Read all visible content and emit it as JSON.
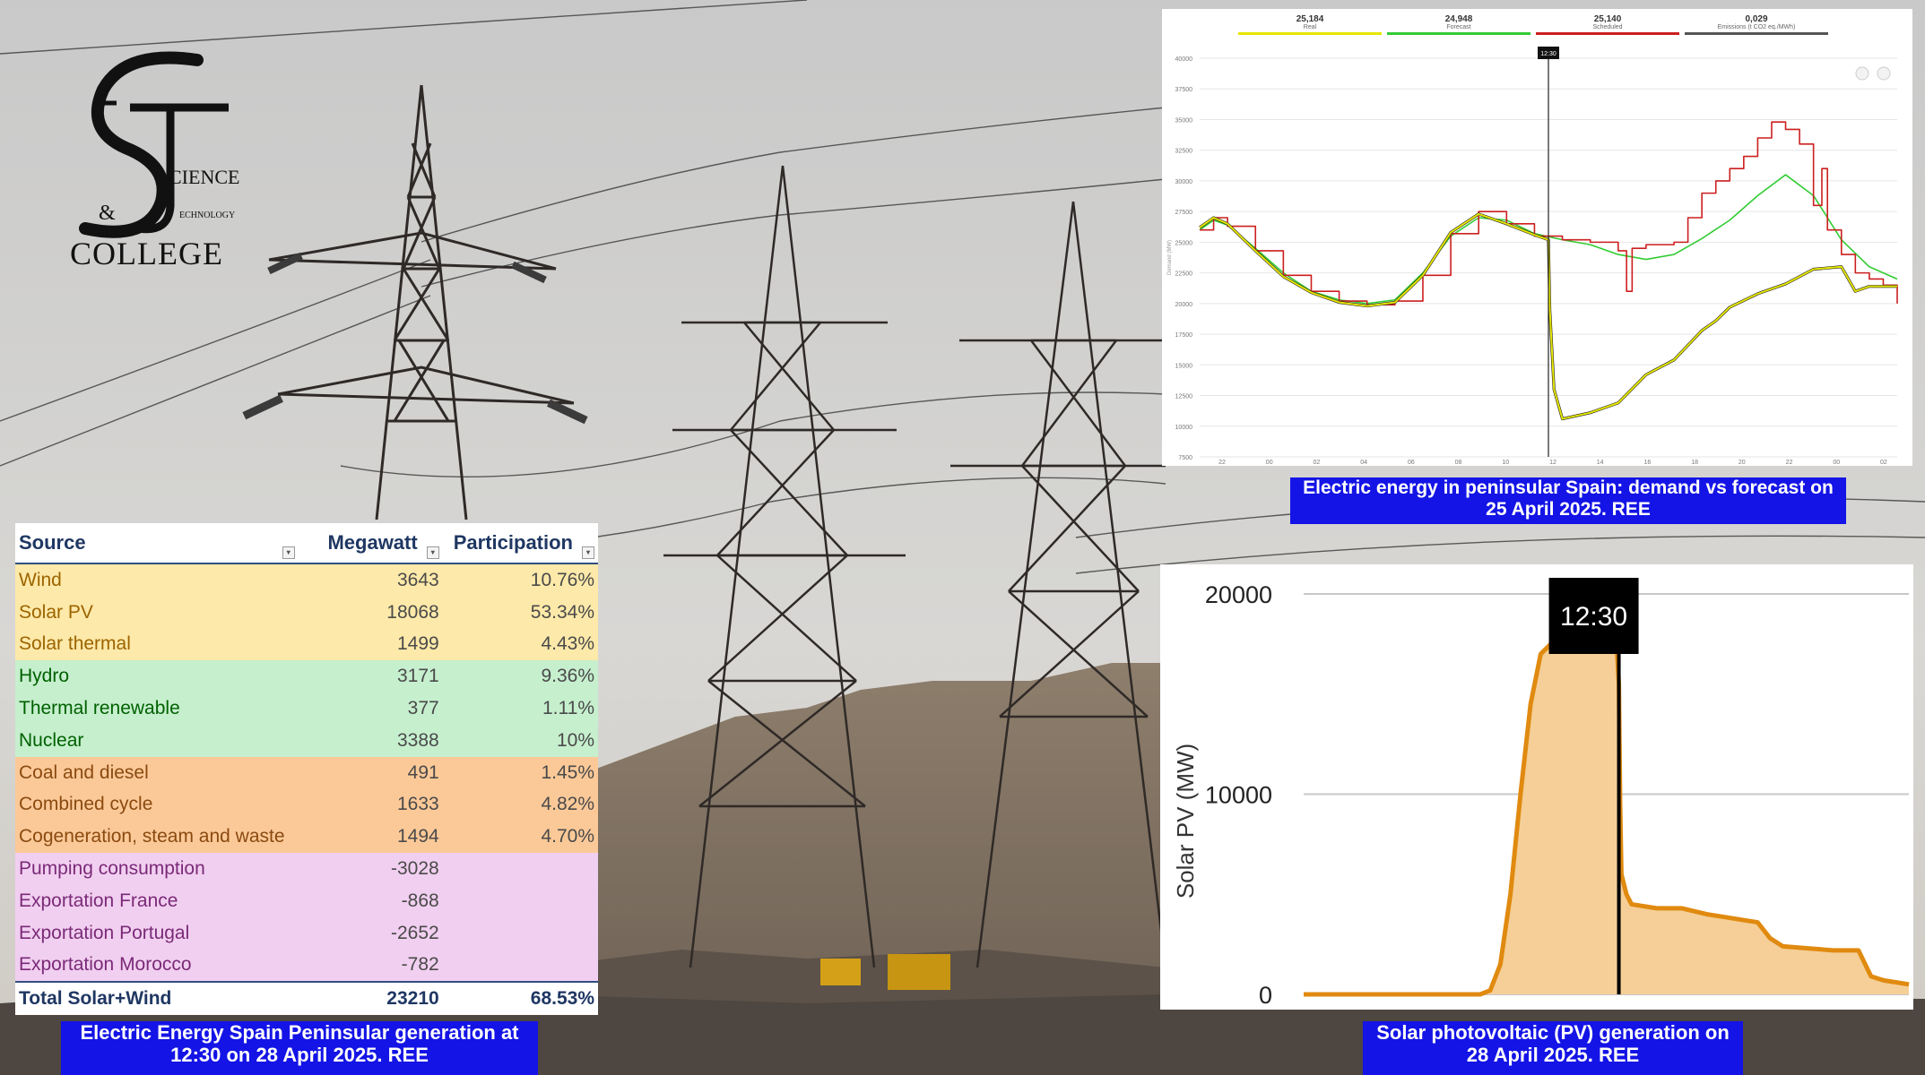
{
  "logo": {
    "line1": "CIENCE",
    "line2": "ECHNOLOGY",
    "line3": "COLLEGE"
  },
  "table": {
    "headers": [
      "Source",
      "Megawatt",
      "Participation"
    ],
    "rows": [
      {
        "source": "Wind",
        "mw": "3643",
        "pct": "10.76%",
        "group": "y"
      },
      {
        "source": "Solar PV",
        "mw": "18068",
        "pct": "53.34%",
        "group": "y"
      },
      {
        "source": "Solar thermal",
        "mw": "1499",
        "pct": "4.43%",
        "group": "y"
      },
      {
        "source": "Hydro",
        "mw": "3171",
        "pct": "9.36%",
        "group": "g"
      },
      {
        "source": "Thermal renewable",
        "mw": "377",
        "pct": "1.11%",
        "group": "g"
      },
      {
        "source": "Nuclear",
        "mw": "3388",
        "pct": "10%",
        "group": "g"
      },
      {
        "source": "Coal and diesel",
        "mw": "491",
        "pct": "1.45%",
        "group": "o"
      },
      {
        "source": "Combined cycle",
        "mw": "1633",
        "pct": "4.82%",
        "group": "o"
      },
      {
        "source": "Cogeneration, steam and waste",
        "mw": "1494",
        "pct": "4.70%",
        "group": "o"
      },
      {
        "source": "Pumping consumption",
        "mw": "-3028",
        "pct": "",
        "group": "p"
      },
      {
        "source": "Exportation France",
        "mw": "-868",
        "pct": "",
        "group": "p"
      },
      {
        "source": "Exportation Portugal",
        "mw": "-2652",
        "pct": "",
        "group": "p"
      },
      {
        "source": "Exportation Morocco",
        "mw": "-782",
        "pct": "",
        "group": "p"
      }
    ],
    "total": {
      "source": "Total Solar+Wind",
      "mw": "23210",
      "pct": "68.53%"
    }
  },
  "captions": {
    "demand": "Electric energy in peninsular Spain: demand vs forecast on 25 April 2025. REE",
    "generation": "Electric Energy Spain Peninsular generation at 12:30 on 28 April 2025. REE",
    "solar": "Solar photovoltaic (PV) generation on 28 April 2025. REE"
  },
  "colors": {
    "real": "#e6e600",
    "forecast": "#33cc33",
    "scheduled": "#cc1f1f",
    "emissions": "#555555",
    "solar_line": "#e08a10",
    "solar_fill": "#f5cf97",
    "caption_bg": "#1414e6"
  },
  "chart_data": [
    {
      "type": "line",
      "legend": [
        {
          "value": "25,184",
          "name": "Real"
        },
        {
          "value": "24,948",
          "name": "Forecast"
        },
        {
          "value": "25,140",
          "name": "Scheduled"
        },
        {
          "value": "0,029",
          "name": "Emissions (t CO2 eq./MWh)"
        }
      ],
      "marker": "12:30",
      "x_ticks": [
        "22",
        "00",
        "02",
        "04",
        "06",
        "08",
        "10",
        "12",
        "14",
        "16",
        "18",
        "20",
        "22",
        "00",
        "02"
      ],
      "y_ticks": [
        7500,
        10000,
        12500,
        15000,
        17500,
        20000,
        22500,
        25000,
        27500,
        30000,
        32500,
        35000,
        37500,
        40000
      ],
      "ylim": [
        7500,
        40000
      ],
      "ylabel": "Demand (MW)",
      "series": [
        {
          "name": "Real",
          "x": [
            0,
            0.5,
            1,
            2,
            3,
            4,
            5,
            6,
            7,
            8,
            9,
            10,
            11,
            12,
            12.5,
            12.55,
            12.7,
            13,
            14,
            15,
            16,
            17,
            18,
            18.5,
            19,
            20,
            21,
            22,
            23,
            23.5,
            24,
            25
          ],
          "y": [
            26200,
            27000,
            26500,
            24300,
            22200,
            20900,
            20100,
            19800,
            20100,
            22300,
            25800,
            27300,
            26500,
            25600,
            25200,
            19500,
            13000,
            10600,
            11100,
            11900,
            14200,
            15400,
            17800,
            18600,
            19700,
            20800,
            21600,
            22800,
            23000,
            21000,
            21400,
            21400
          ]
        },
        {
          "name": "Forecast",
          "x": [
            0,
            0.5,
            1,
            2,
            3,
            4,
            5,
            6,
            7,
            8,
            9,
            10,
            11,
            12,
            13,
            14,
            15,
            16,
            17,
            18,
            19,
            20,
            21,
            22,
            23,
            24,
            25
          ],
          "y": [
            26000,
            26800,
            26400,
            24500,
            22500,
            21000,
            20300,
            20000,
            20300,
            22500,
            25500,
            27000,
            26800,
            25700,
            25200,
            24800,
            24000,
            23600,
            24000,
            25300,
            26800,
            28800,
            30500,
            28800,
            25200,
            23000,
            22000
          ]
        },
        {
          "name": "Scheduled",
          "x": [
            0,
            0.5,
            1,
            2,
            3,
            4,
            5,
            6,
            7,
            8,
            9,
            10,
            11,
            12,
            13,
            14,
            15,
            15.3,
            15.5,
            16,
            17,
            17.5,
            18,
            18.5,
            19,
            19.5,
            20,
            20.5,
            21,
            21.5,
            22,
            22.3,
            22.5,
            23,
            23.5,
            24,
            24.5,
            25
          ],
          "y": [
            26000,
            27000,
            26300,
            24300,
            22300,
            21000,
            20200,
            19900,
            20200,
            22300,
            25700,
            27500,
            26500,
            25500,
            25200,
            25000,
            24300,
            21000,
            24500,
            24800,
            25000,
            27000,
            29000,
            30000,
            31000,
            32000,
            33500,
            34800,
            34200,
            33000,
            28000,
            31000,
            26000,
            24000,
            22500,
            22000,
            21500,
            20000
          ]
        }
      ]
    },
    {
      "type": "area",
      "marker": "12:30",
      "ylabel": "Solar PV (MW)",
      "y_ticks": [
        0,
        10000,
        20000
      ],
      "ylim": [
        0,
        20000
      ],
      "xlim": [
        0,
        24
      ],
      "series": [
        {
          "name": "Solar PV",
          "x": [
            0,
            3,
            6,
            7,
            7.4,
            7.8,
            8.2,
            8.6,
            9.0,
            9.4,
            9.8,
            10.2,
            10.6,
            11,
            11.5,
            12,
            12.4,
            12.5,
            12.55,
            12.6,
            12.8,
            13,
            14,
            15,
            16,
            17,
            18,
            18.5,
            19,
            20,
            21,
            22,
            22.5,
            23,
            24
          ],
          "y": [
            0,
            0,
            0,
            0,
            200,
            1500,
            5000,
            10000,
            14500,
            17000,
            17500,
            17800,
            17800,
            17800,
            17800,
            17800,
            17800,
            15500,
            9500,
            6000,
            5000,
            4500,
            4300,
            4300,
            4000,
            3800,
            3600,
            2800,
            2400,
            2300,
            2200,
            2200,
            900,
            700,
            500
          ]
        }
      ]
    }
  ]
}
